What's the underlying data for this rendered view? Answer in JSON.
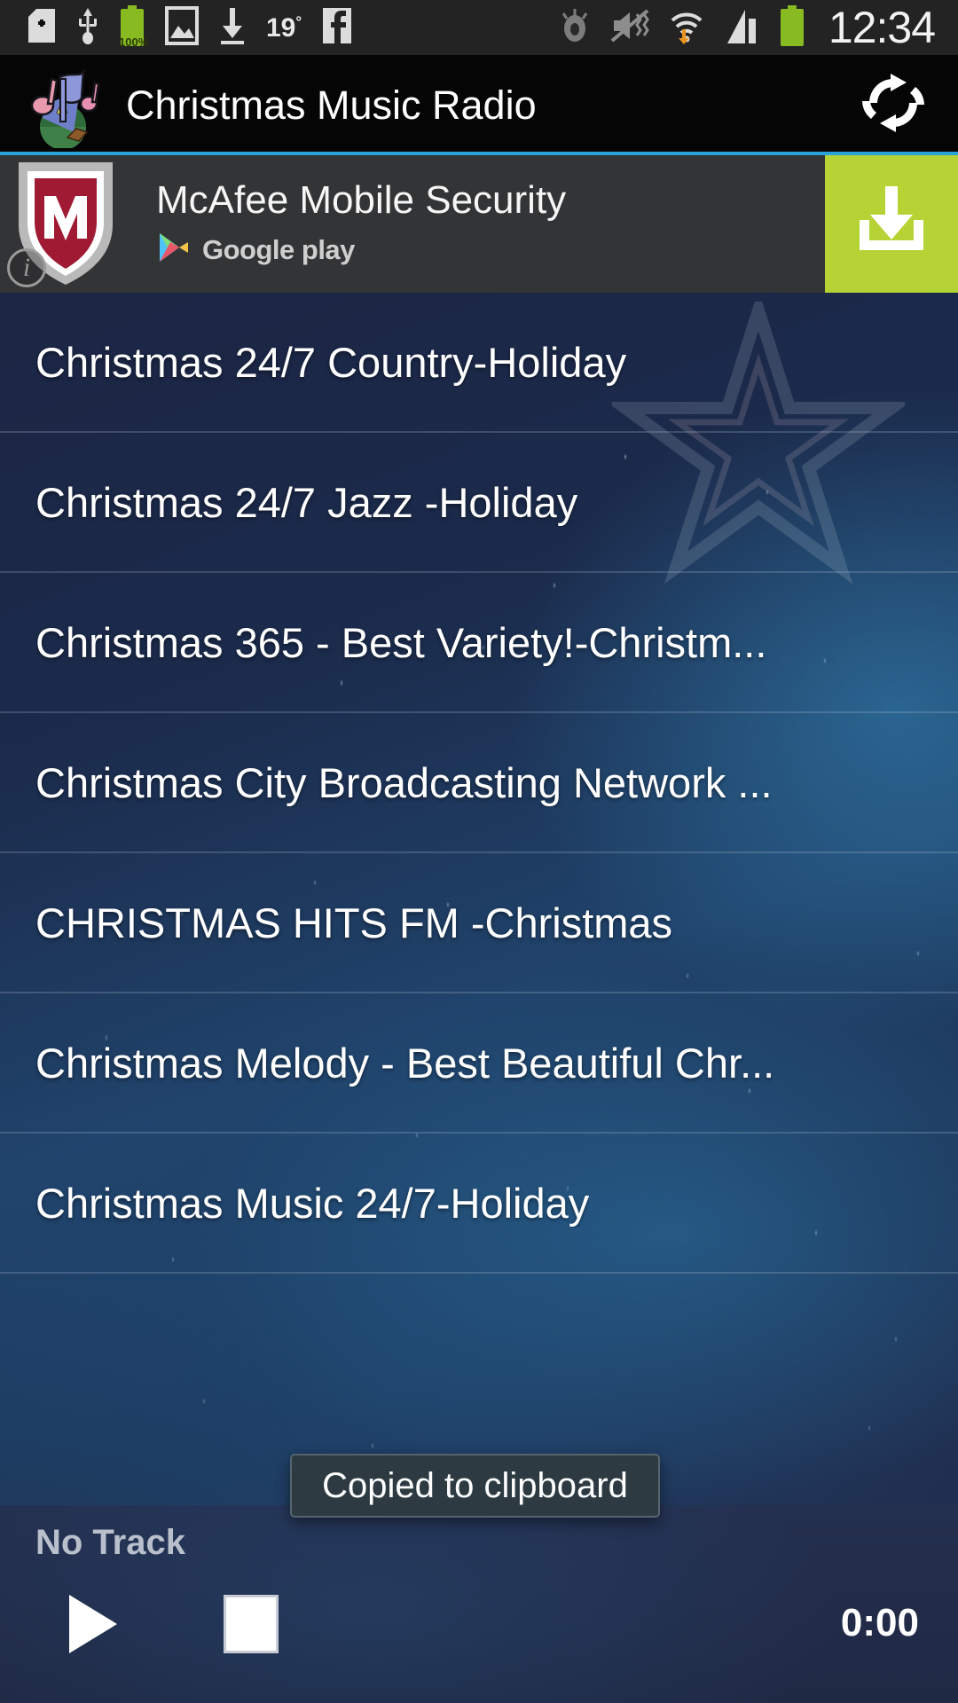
{
  "status_bar": {
    "clock": "12:34",
    "temperature": "19",
    "temperature_unit": "°",
    "battery_percent": "100%",
    "icons": [
      "sd-card-icon",
      "usb-icon",
      "battery-charging-icon",
      "screenshot-image-icon",
      "download-icon",
      "weather-temp-icon",
      "facebook-icon",
      "smart-stay-eye-icon",
      "mute-vibrate-off-icon",
      "wifi-transfer-icon",
      "cellular-signal-icon",
      "battery-icon"
    ]
  },
  "action_bar": {
    "app_icon": "christmas-music-note-icon",
    "title": "Christmas Music Radio",
    "refresh_icon": "refresh-icon",
    "overflow_icon": "overflow-triangle-icon"
  },
  "ad_banner": {
    "advertiser_logo": "mcafee-shield-icon",
    "title": "McAfee Mobile Security",
    "store_icon": "google-play-icon",
    "store_label": "Google play",
    "cta_icon": "download-icon",
    "info_badge": "i",
    "accent_color": "#b5d335",
    "top_rule_color": "#2aa3d8"
  },
  "station_list": {
    "items": [
      {
        "label": "Christmas 24/7 Country-Holiday"
      },
      {
        "label": "Christmas 24/7 Jazz  -Holiday"
      },
      {
        "label": "Christmas 365 - Best Variety!-Christm..."
      },
      {
        "label": "Christmas City Broadcasting Network ..."
      },
      {
        "label": "CHRISTMAS HITS FM -Christmas"
      },
      {
        "label": "Christmas Melody - Best Beautiful Chr..."
      },
      {
        "label": "Christmas Music 24/7-Holiday"
      }
    ]
  },
  "toast": {
    "message": "Copied to clipboard"
  },
  "player": {
    "track_status": "No Track",
    "play_icon": "play-icon",
    "stop_icon": "stop-icon",
    "elapsed_time": "0:00"
  }
}
